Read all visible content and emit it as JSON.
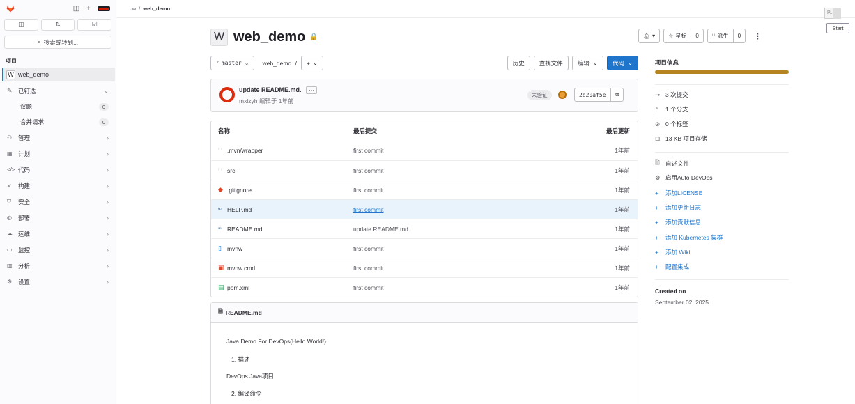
{
  "breadcrumb": {
    "group": "cw",
    "separator": "/",
    "project": "web_demo"
  },
  "overlay": {
    "p_label": "P...",
    "start_label": "Start"
  },
  "sidebar": {
    "search_placeholder": "搜索或转到...",
    "section_title": "项目",
    "project_avatar": "W",
    "project_name": "web_demo",
    "pinned_label": "已钉选",
    "pinned_items": [
      {
        "label": "议题",
        "count": "0"
      },
      {
        "label": "合并请求",
        "count": "0"
      }
    ],
    "nav": [
      {
        "label": "管理",
        "icon": "users-icon"
      },
      {
        "label": "计划",
        "icon": "calendar-icon"
      },
      {
        "label": "代码",
        "icon": "code-icon"
      },
      {
        "label": "构建",
        "icon": "rocket-icon"
      },
      {
        "label": "安全",
        "icon": "shield-icon"
      },
      {
        "label": "部署",
        "icon": "deploy-icon"
      },
      {
        "label": "运维",
        "icon": "cloud-icon"
      },
      {
        "label": "监控",
        "icon": "monitor-icon"
      },
      {
        "label": "分析",
        "icon": "chart-icon"
      },
      {
        "label": "设置",
        "icon": "gear-icon"
      }
    ]
  },
  "project": {
    "avatar": "W",
    "title": "web_demo",
    "notify_label": "▾",
    "star_label": "星标",
    "star_count": "0",
    "fork_label": "派生",
    "fork_count": "0"
  },
  "toolbar": {
    "branch": "master",
    "path": "web_demo",
    "path_sep": "/",
    "add_label": "+",
    "history": "历史",
    "find_file": "查找文件",
    "edit": "编辑",
    "code": "代码"
  },
  "commit": {
    "message": "update README.md.",
    "author": "mxlzyh",
    "authored_text": "编辑于 1年前",
    "badge": "未验证",
    "sha": "2d20af5e"
  },
  "files": {
    "headers": {
      "name": "名称",
      "last_commit": "最后提交",
      "last_update": "最后更新"
    },
    "rows": [
      {
        "icon": "folder-icon",
        "glyph": "🗀",
        "name": ".mvn/wrapper",
        "commit": "first commit",
        "updated": "1年前",
        "link": false,
        "color": "#535158"
      },
      {
        "icon": "folder-icon",
        "glyph": "🗀",
        "name": "src",
        "commit": "first commit",
        "updated": "1年前",
        "link": false,
        "color": "#535158"
      },
      {
        "icon": "git-icon",
        "glyph": "◆",
        "name": ".gitignore",
        "commit": "first commit",
        "updated": "1年前",
        "link": false,
        "color": "#e24329"
      },
      {
        "icon": "markdown-icon",
        "glyph": "ᴹᴰ",
        "name": "HELP.md",
        "commit": "first commit",
        "updated": "1年前",
        "link": true,
        "color": "#1f75cb"
      },
      {
        "icon": "markdown-icon",
        "glyph": "ᴹᴰ",
        "name": "README.md",
        "commit": "update README.md.",
        "updated": "1年前",
        "link": false,
        "color": "#1f75cb"
      },
      {
        "icon": "file-icon",
        "glyph": "▯",
        "name": "mvnw",
        "commit": "first commit",
        "updated": "1年前",
        "link": false,
        "color": "#1f75cb"
      },
      {
        "icon": "terminal-icon",
        "glyph": "▣",
        "name": "mvnw.cmd",
        "commit": "first commit",
        "updated": "1年前",
        "link": false,
        "color": "#e24329"
      },
      {
        "icon": "xml-icon",
        "glyph": "▤",
        "name": "pom.xml",
        "commit": "first commit",
        "updated": "1年前",
        "link": false,
        "color": "#2da160"
      }
    ]
  },
  "readme": {
    "title": "README.md",
    "lines": [
      {
        "text": "Java Demo For DevOps(Hello World!)",
        "indent": false
      },
      {
        "text": "1. 描述",
        "indent": true
      },
      {
        "text": "DevOps Java项目",
        "indent": false
      },
      {
        "text": "2. 编译命令",
        "indent": true
      }
    ]
  },
  "info": {
    "title": "项目信息",
    "stats": [
      {
        "icon": "commit-icon",
        "glyph": "⊸",
        "text": "3 次提交"
      },
      {
        "icon": "branch-icon",
        "glyph": "ᚠ",
        "text": "1 个分支"
      },
      {
        "icon": "tag-icon",
        "glyph": "⊘",
        "text": "0 个标签"
      },
      {
        "icon": "storage-icon",
        "glyph": "⊟",
        "text": "13 KB 项目存储"
      }
    ],
    "links": [
      {
        "icon": "doc-icon",
        "glyph": "🗎",
        "text": "自述文件",
        "accent": false
      },
      {
        "icon": "devops-icon",
        "glyph": "⚙",
        "text": "启用Auto DevOps",
        "accent": false
      },
      {
        "icon": "plus-icon",
        "glyph": "+",
        "text": "添加LICENSE",
        "accent": true
      },
      {
        "icon": "plus-icon",
        "glyph": "+",
        "text": "添加更新日志",
        "accent": true
      },
      {
        "icon": "plus-icon",
        "glyph": "+",
        "text": "添加贡献信息",
        "accent": true
      },
      {
        "icon": "plus-icon",
        "glyph": "+",
        "text": "添加 Kubernetes 集群",
        "accent": true
      },
      {
        "icon": "plus-icon",
        "glyph": "+",
        "text": "添加 Wiki",
        "accent": true
      },
      {
        "icon": "plus-icon",
        "glyph": "+",
        "text": "配置集成",
        "accent": true
      }
    ],
    "created_label": "Created on",
    "created_date": "September 02, 2025"
  },
  "colors": {
    "accent": "#1f75cb",
    "language_bar": "#b5831f",
    "brand": "#e24329"
  }
}
